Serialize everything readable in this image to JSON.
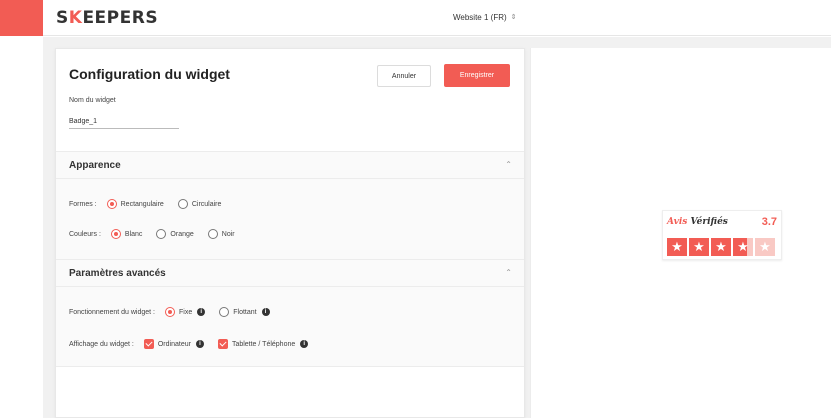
{
  "header": {
    "logo_pre": "S",
    "logo_k": "K",
    "logo_post": "EEPERS",
    "site_select": "Website 1 (FR)",
    "site_caret": "⇕"
  },
  "panel": {
    "title": "Configuration du widget",
    "cancel_label": "Annuler",
    "save_label": "Enregistrer",
    "name_label": "Nom du widget",
    "name_value": "Badge_1"
  },
  "appearance": {
    "title": "Apparence",
    "shapes_label": "Formes :",
    "shapes": [
      {
        "label": "Rectangulaire",
        "selected": true
      },
      {
        "label": "Circulaire",
        "selected": false
      }
    ],
    "colors_label": "Couleurs :",
    "colors": [
      {
        "label": "Blanc",
        "selected": true
      },
      {
        "label": "Orange",
        "selected": false
      },
      {
        "label": "Noir",
        "selected": false
      }
    ]
  },
  "advanced": {
    "title": "Paramètres avancés",
    "behavior_label": "Fonctionnement du widget :",
    "behavior": [
      {
        "label": "Fixe",
        "selected": true
      },
      {
        "label": "Flottant",
        "selected": false
      }
    ],
    "display_label": "Affichage du widget :",
    "display": [
      {
        "label": "Ordinateur",
        "checked": true
      },
      {
        "label": "Tablette / Téléphone",
        "checked": true
      }
    ]
  },
  "badge": {
    "brand_avis": "Avis",
    "brand_rest": " Vérifiés",
    "score": "3.7",
    "rating": 3.7,
    "max_stars": 5
  },
  "colors": {
    "accent": "#f25c54",
    "star_empty": "#f9c9c4"
  }
}
